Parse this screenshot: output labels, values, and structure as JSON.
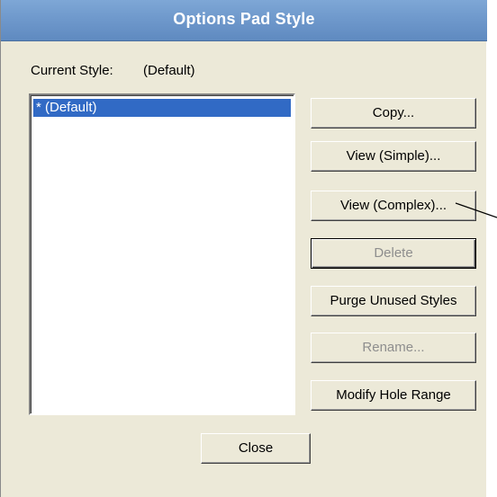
{
  "dialog": {
    "title": "Options Pad Style",
    "current_style_label": "Current Style:",
    "current_style_value": "(Default)"
  },
  "style_list": {
    "items": [
      "* (Default)"
    ],
    "selected_index": 0
  },
  "buttons": {
    "copy": "Copy...",
    "view_simple": "View (Simple)...",
    "view_complex": "View (Complex)...",
    "delete": "Delete",
    "purge": "Purge Unused Styles",
    "rename": "Rename...",
    "modify_hole_range": "Modify Hole Range",
    "close": "Close"
  },
  "colors": {
    "title_bar": "#6f99cc",
    "dialog_bg": "#ece9d8",
    "selection": "#316ac5",
    "disabled_text": "#8e8e8e"
  }
}
